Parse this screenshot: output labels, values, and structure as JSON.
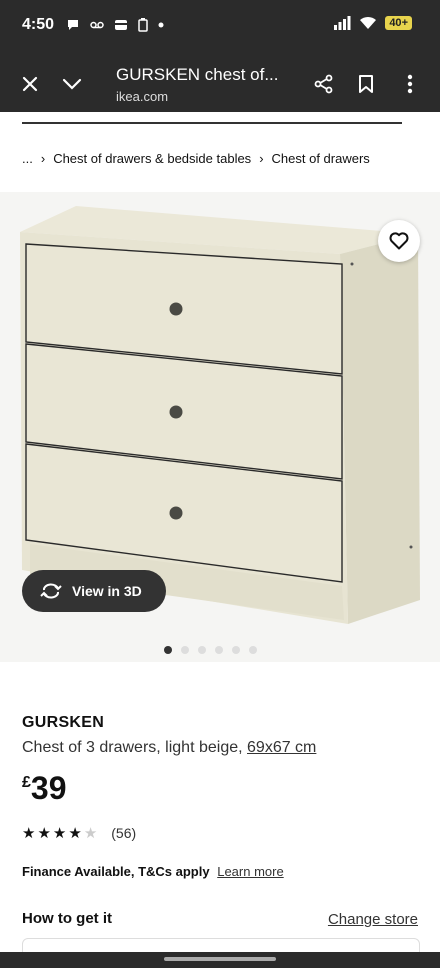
{
  "status": {
    "time": "4:50",
    "battery": "40"
  },
  "browser": {
    "title": "GURSKEN chest of...",
    "url": "ikea.com"
  },
  "breadcrumb": [
    "...",
    "Chest of drawers & bedside tables",
    "Chest of drawers"
  ],
  "image": {
    "view3d_label": "View in 3D",
    "slide_count": 6,
    "active_slide": 1
  },
  "product": {
    "brand": "GURSKEN",
    "description": "Chest of 3 drawers, light beige,",
    "size_link": "69x67 cm",
    "currency": "£",
    "price": "39",
    "rating_stars": 4,
    "rating_max": 5,
    "rating_count": "(56)"
  },
  "finance": {
    "text": "Finance Available, T&Cs apply",
    "link": "Learn more"
  },
  "get_it": {
    "title": "How to get it",
    "change_store": "Change store"
  },
  "colors": {
    "bar": "#2b2b2b",
    "battery": "#e8d44d",
    "furniture": "#e7e4d2"
  }
}
